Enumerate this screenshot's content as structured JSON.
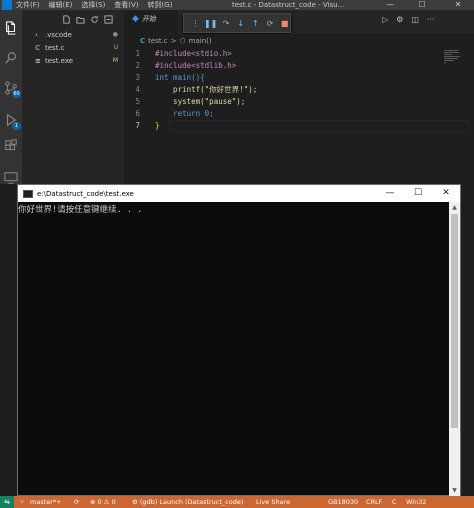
{
  "window": {
    "title": "test.c - Datastruct_code - Visu...",
    "menu": [
      "文件(F)",
      "编辑(E)",
      "选择(S)",
      "查看(V)",
      "转到(G)"
    ],
    "minimize": "—",
    "maximize": "☐",
    "close": "✕"
  },
  "activity": {
    "scm_badge": "60",
    "debug_badge": "1"
  },
  "explorer": {
    "items": [
      {
        "label": ".vscode",
        "status": "●"
      },
      {
        "label": "test.c",
        "status": "U"
      },
      {
        "label": "test.exe",
        "status": "M"
      }
    ]
  },
  "debug": {
    "launch_label": "开始"
  },
  "breadcrumb": {
    "file": "test.c",
    "separator": ">",
    "symbol": "main()"
  },
  "code": {
    "lines": [
      {
        "num": "1",
        "text": "#include<stdio.h>"
      },
      {
        "num": "2",
        "text": "#include<stdlib.h>"
      },
      {
        "num": "3",
        "text": "int main(){"
      },
      {
        "num": "4",
        "text": "    printf(\"你好世界!\");"
      },
      {
        "num": "5",
        "text": "    system(\"pause\");"
      },
      {
        "num": "6",
        "text": "    return 0;"
      },
      {
        "num": "7",
        "text": "}"
      }
    ]
  },
  "console": {
    "title": "e:\\Datastruct_code\\test.exe",
    "output": "你好世界!请按任意键继续. . .",
    "minimize": "—",
    "maximize": "☐",
    "close": "✕"
  },
  "statusbar": {
    "branch": "master*+",
    "sync": "⟳",
    "problems": "⊗ 0 ⚠ 0",
    "launch": "⚙ (gdb) Launch (Datastruct_code)",
    "live_share": "Live Share",
    "encoding": "GB18030",
    "eol": "CRLF",
    "language": "C",
    "platform": "Win32"
  },
  "colors": {
    "statusbar": "#cc6633",
    "activity": "#333333",
    "editor": "#1e1e1e",
    "accent": "#0e639c"
  }
}
